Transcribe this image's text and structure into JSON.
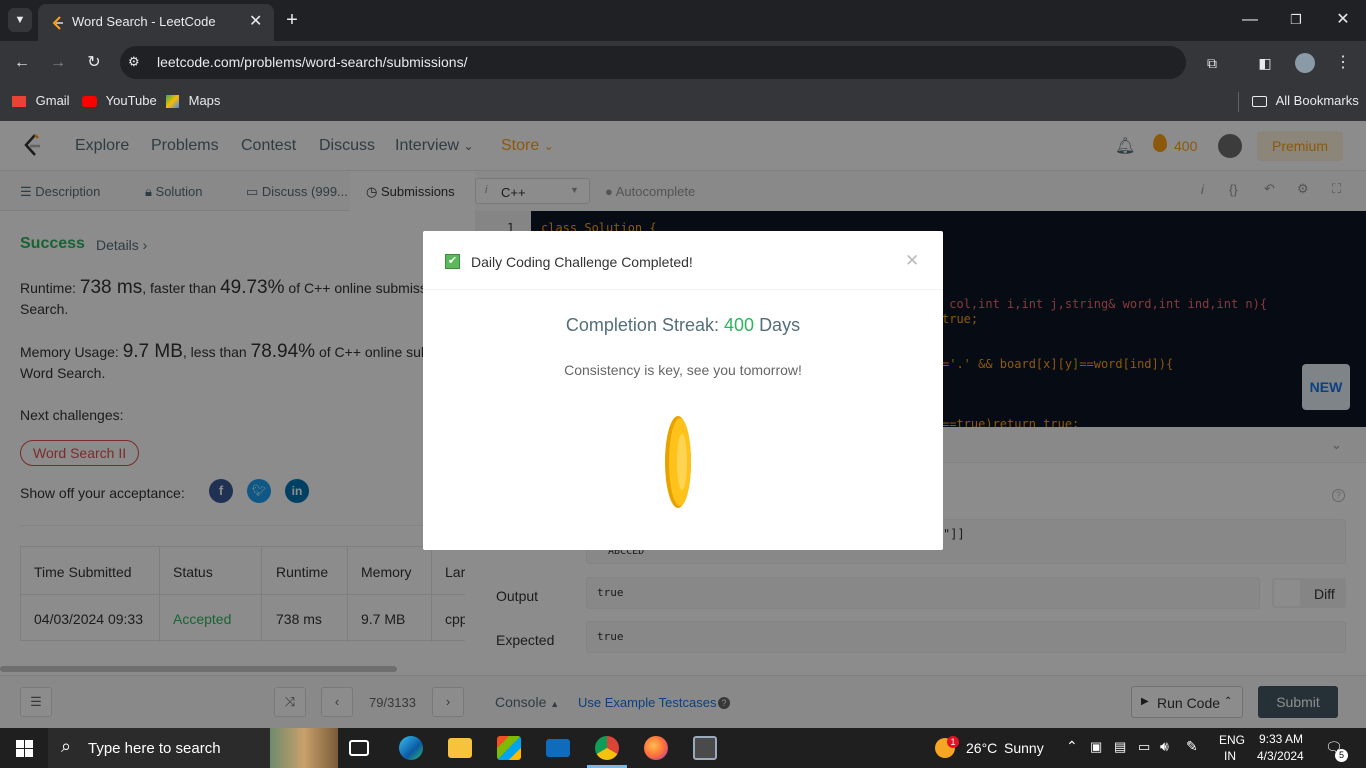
{
  "browser": {
    "tab_title": "Word Search - LeetCode",
    "url": "leetcode.com/problems/word-search/submissions/",
    "bookmarks": [
      "Gmail",
      "YouTube",
      "Maps"
    ],
    "all_bookmarks": "All Bookmarks"
  },
  "nav": {
    "items": [
      "Explore",
      "Problems",
      "Contest",
      "Discuss",
      "Interview",
      "Store"
    ],
    "streak_count": "400",
    "premium": "Premium"
  },
  "left_tabs": [
    "Description",
    "Solution",
    "Discuss (999...",
    "Submissions"
  ],
  "result": {
    "status": "Success",
    "details": "Details",
    "runtime_label": "Runtime:",
    "runtime_value": "738 ms",
    "runtime_mid": ", faster than",
    "runtime_pct": "49.73%",
    "runtime_tail": "of C++ online submissions for Word",
    "runtime_tail2": "Search.",
    "memory_label": "Memory Usage:",
    "memory_value": "9.7 MB",
    "memory_mid": ", less than",
    "memory_pct": "78.94%",
    "memory_tail": "of C++ online submissions for",
    "memory_tail2": "Word Search.",
    "next_challenges": "Next challenges:",
    "challenge_tag": "Word Search II",
    "show_off": "Show off your acceptance:"
  },
  "table": {
    "headers": [
      "Time Submitted",
      "Status",
      "Runtime",
      "Memory",
      "Lar"
    ],
    "row": [
      "04/03/2024 09:33",
      "Accepted",
      "738 ms",
      "9.7 MB",
      "cpp"
    ]
  },
  "editor": {
    "language": "C++",
    "autocomplete": "Autocomplete",
    "line1": "class Solution {",
    "line_num": "1",
    "frag1": " col,int i,int j,string& word,int ind,int n){",
    "frag2": "true;",
    "frag3": "='.' && board[x][y]==word[ind]){",
    "frag4": "==true)return true;",
    "new_badge": "NEW"
  },
  "console": {
    "frag_input": "\"]]",
    "input_word": "\"ABCCED\"",
    "output_label": "Output",
    "output_value": "true",
    "expected_label": "Expected",
    "expected_value": "true",
    "diff": "Diff"
  },
  "bottom": {
    "page": "79/3133",
    "console": "Console",
    "use_example": "Use Example Testcases",
    "run_code": "Run Code",
    "submit": "Submit"
  },
  "modal": {
    "title": "Daily Coding Challenge Completed!",
    "streak_label": "Completion Streak:",
    "streak_num": "400",
    "streak_unit": "Days",
    "message": "Consistency is key, see you tomorrow!"
  },
  "taskbar": {
    "search": "Type here to search",
    "weather_temp": "26°C",
    "weather_text": "Sunny",
    "lang1": "ENG",
    "lang2": "IN",
    "time": "9:33 AM",
    "date": "4/3/2024",
    "weather_badge": "1",
    "notif_count": "5"
  },
  "colors": {
    "accent_green": "#2db55d",
    "leetcode_orange": "#ffa116",
    "modal_green": "#5cb85c"
  }
}
